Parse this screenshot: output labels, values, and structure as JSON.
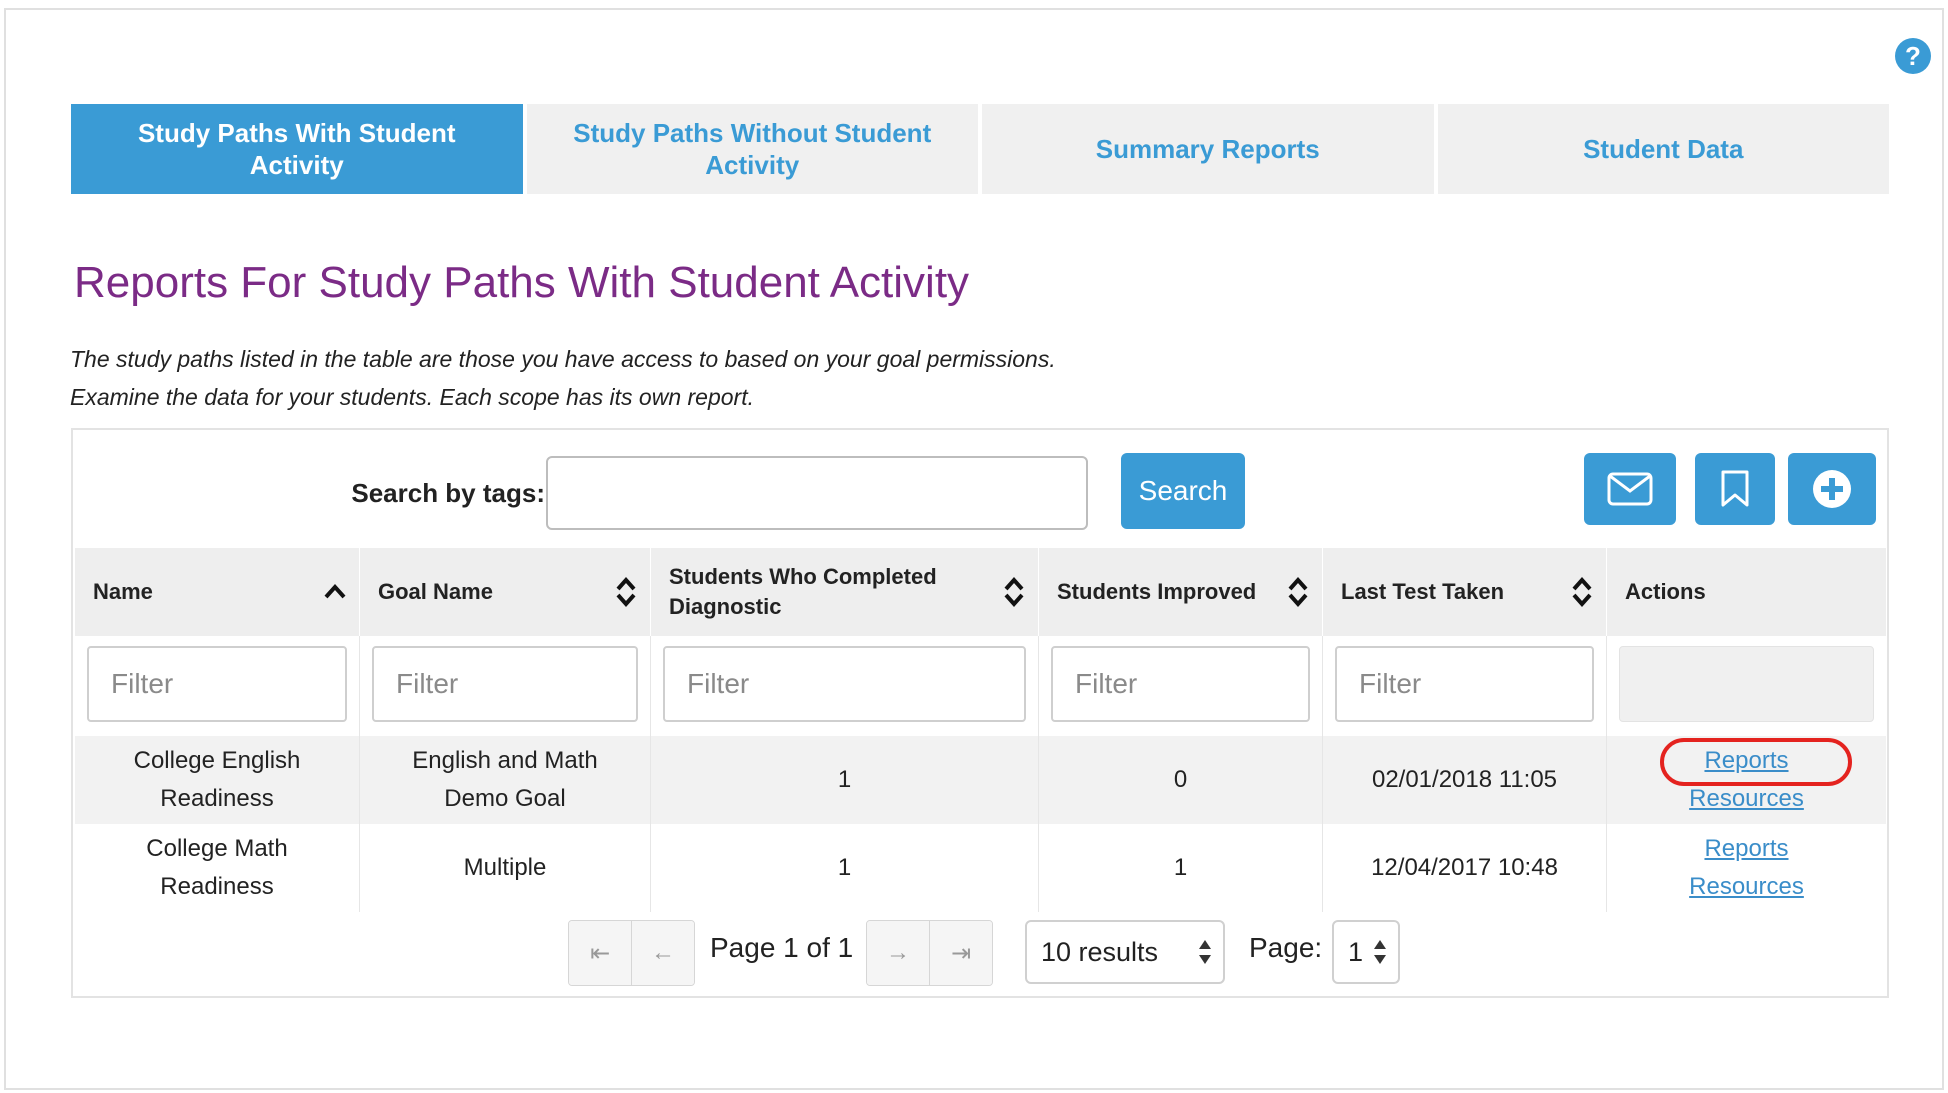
{
  "tabs": [
    {
      "label": "Study Paths With Student Activity",
      "active": true
    },
    {
      "label": "Study Paths Without Student Activity",
      "active": false
    },
    {
      "label": "Summary Reports",
      "active": false
    },
    {
      "label": "Student Data",
      "active": false
    }
  ],
  "help": {
    "label": "?"
  },
  "page_title": "Reports For Study Paths With Student Activity",
  "description": {
    "line1": "The study paths listed in the table are those you have access to based on your goal permissions.",
    "line2": "Examine the data for your students. Each scope has its own report."
  },
  "search": {
    "label": "Search by tags:",
    "value": "",
    "placeholder": "",
    "button_label": "Search"
  },
  "toolbar_icons": [
    "envelope-icon",
    "bookmark-icon",
    "plus-circle-icon"
  ],
  "table": {
    "columns": [
      {
        "label": "Name",
        "sort": "asc"
      },
      {
        "label": "Goal Name",
        "sort": "both"
      },
      {
        "label": "Students Who Completed Diagnostic",
        "sort": "both"
      },
      {
        "label": "Students Improved",
        "sort": "both"
      },
      {
        "label": "Last Test Taken",
        "sort": "both"
      },
      {
        "label": "Actions",
        "sort": "none"
      }
    ],
    "filter_placeholder": "Filter",
    "rows": [
      {
        "name": "College English Readiness",
        "goal_name": "English and Math Demo Goal",
        "completed": "1",
        "improved": "0",
        "last_test": "02/01/2018 11:05",
        "actions": [
          "Reports",
          "Resources"
        ]
      },
      {
        "name": "College Math Readiness",
        "goal_name": "Multiple",
        "completed": "1",
        "improved": "1",
        "last_test": "12/04/2017 10:48",
        "actions": [
          "Reports",
          "Resources"
        ]
      }
    ]
  },
  "pagination": {
    "first": "⇤",
    "prev": "←",
    "next": "→",
    "last": "⇥",
    "page_text": "Page 1 of 1",
    "results_select": "10 results",
    "page_label": "Page:",
    "page_value": "1"
  },
  "colors": {
    "accent": "#3a9bd5",
    "title": "#7b2b86",
    "highlight": "#e4231f"
  }
}
